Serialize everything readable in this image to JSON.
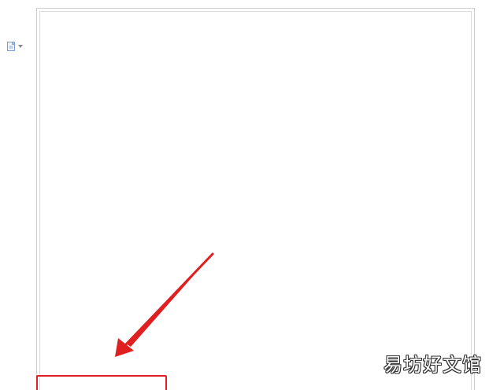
{
  "toolbar": {
    "paste_options_icon": "paste-options-icon",
    "dropdown_icon": "chevron-down-icon"
  },
  "document": {
    "body_text": ""
  },
  "annotation": {
    "arrow_color": "#e02020",
    "box_color": "#e02020"
  },
  "watermark": {
    "text": "易坊好文馆"
  }
}
